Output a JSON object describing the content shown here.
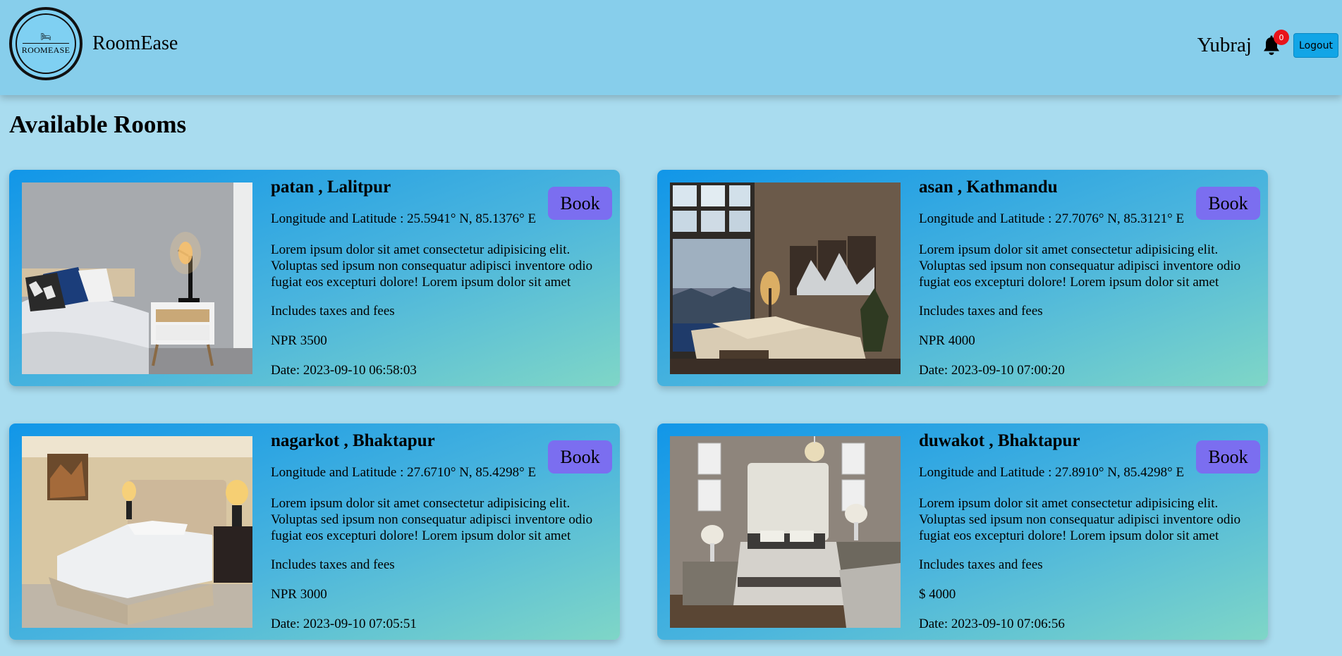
{
  "header": {
    "logo_text": "ROOMEASE",
    "brand": "RoomEase",
    "user_name": "Yubraj",
    "notification_count": "0",
    "logout_label": "Logout"
  },
  "main": {
    "title": "Available Rooms"
  },
  "rooms": [
    {
      "title": "patan , Lalitpur",
      "coords": "Longitude and Latitude : 25.5941° N, 85.1376° E",
      "description": "Lorem ipsum dolor sit amet consectetur adipisicing elit. Voluptas sed ipsum non consequatur adipisci inventore odio fugiat eos excepturi dolore! Lorem ipsum dolor sit amet",
      "taxes": "Includes taxes and fees",
      "price": "NPR 3500",
      "date": "Date: 2023-09-10 06:58:03",
      "book_label": "Book"
    },
    {
      "title": "asan , Kathmandu",
      "coords": "Longitude and Latitude : 27.7076° N, 85.3121° E",
      "description": "Lorem ipsum dolor sit amet consectetur adipisicing elit. Voluptas sed ipsum non consequatur adipisci inventore odio fugiat eos excepturi dolore! Lorem ipsum dolor sit amet",
      "taxes": "Includes taxes and fees",
      "price": "NPR 4000",
      "date": "Date: 2023-09-10 07:00:20",
      "book_label": "Book"
    },
    {
      "title": "nagarkot , Bhaktapur",
      "coords": "Longitude and Latitude : 27.6710° N, 85.4298° E",
      "description": "Lorem ipsum dolor sit amet consectetur adipisicing elit. Voluptas sed ipsum non consequatur adipisci inventore odio fugiat eos excepturi dolore! Lorem ipsum dolor sit amet",
      "taxes": "Includes taxes and fees",
      "price": "NPR 3000",
      "date": "Date: 2023-09-10 07:05:51",
      "book_label": "Book"
    },
    {
      "title": "duwakot , Bhaktapur",
      "coords": "Longitude and Latitude : 27.8910° N, 85.4298° E",
      "description": "Lorem ipsum dolor sit amet consectetur adipisicing elit. Voluptas sed ipsum non consequatur adipisci inventore odio fugiat eos excepturi dolore! Lorem ipsum dolor sit amet",
      "taxes": "Includes taxes and fees",
      "price": "$ 4000",
      "date": "Date: 2023-09-10 07:06:56",
      "book_label": "Book"
    }
  ],
  "icons": {
    "bell": "bell-icon",
    "logo": "bed-icon"
  },
  "colors": {
    "header_bg": "#87ceeb",
    "page_bg": "#a9dcef",
    "book_button": "#7b6ef0",
    "logout_button": "#12a5e6",
    "badge": "#e8141a"
  }
}
